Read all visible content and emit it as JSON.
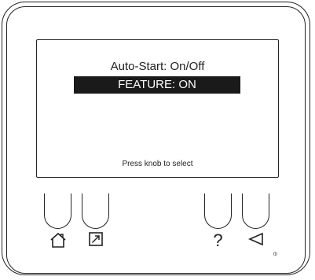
{
  "display": {
    "title": "Auto-Start: On/Off",
    "selected_option": "FEATURE: ON",
    "hint": "Press knob to select"
  },
  "softkeys": {
    "home": {
      "icon": "home-icon"
    },
    "external": {
      "icon": "external-link-icon"
    },
    "help": {
      "label": "?",
      "icon": "question-mark-icon"
    },
    "back": {
      "icon": "back-triangle-icon"
    }
  },
  "footer_mark": "⦶"
}
